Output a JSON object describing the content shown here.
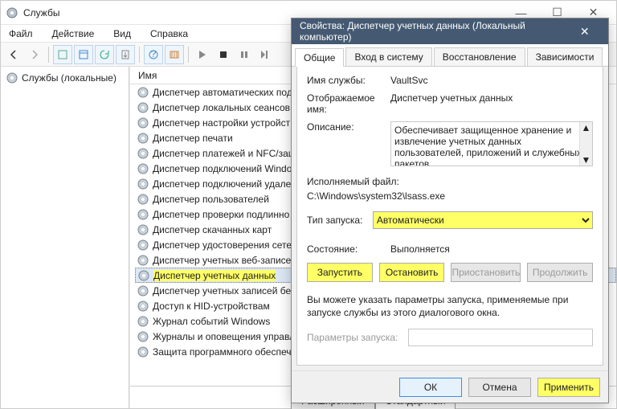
{
  "window": {
    "title": "Службы",
    "menu": [
      "Файл",
      "Действие",
      "Вид",
      "Справка"
    ]
  },
  "tree": {
    "root": "Службы (локальные)"
  },
  "list": {
    "col": "Имя",
    "items": [
      "Диспетчер автоматических под…",
      "Диспетчер локальных сеансов",
      "Диспетчер настройки устройст…",
      "Диспетчер печати",
      "Диспетчер платежей и NFC/защ…",
      "Диспетчер подключений Windo…",
      "Диспетчер подключений удален…",
      "Диспетчер пользователей",
      "Диспетчер проверки подлинно…",
      "Диспетчер скачанных карт",
      "Диспетчер удостоверения сетев…",
      "Диспетчер учетных веб-записе…",
      "Диспетчер учетных данных",
      "Диспетчер учетных записей без…",
      "Доступ к HID-устройствам",
      "Журнал событий Windows",
      "Журналы и оповещения управле…",
      "Защита программного обеспеч…"
    ],
    "selected_index": 12,
    "view_tabs": {
      "extended": "Расширенный",
      "standard": "Стандартный"
    }
  },
  "dialog": {
    "title": "Свойства: Диспетчер учетных данных (Локальный компьютер)",
    "tabs": [
      "Общие",
      "Вход в систему",
      "Восстановление",
      "Зависимости"
    ],
    "labels": {
      "service_name": "Имя службы:",
      "display_name": "Отображаемое имя:",
      "description": "Описание:",
      "exe": "Исполняемый файл:",
      "startup": "Тип запуска:",
      "state": "Состояние:",
      "note": "Вы можете указать параметры запуска, применяемые при запуске службы из этого диалогового окна.",
      "params": "Параметры запуска:"
    },
    "values": {
      "service_name": "VaultSvc",
      "display_name": "Диспетчер учетных данных",
      "description": "Обеспечивает защищенное хранение и извлечение учетных данных пользователей, приложений и служебных пакетов.",
      "exe": "C:\\Windows\\system32\\lsass.exe",
      "startup": "Автоматически",
      "state": "Выполняется"
    },
    "buttons": {
      "start": "Запустить",
      "stop": "Остановить",
      "pause": "Приостановить",
      "resume": "Продолжить",
      "ok": "ОК",
      "cancel": "Отмена",
      "apply": "Применить"
    }
  }
}
